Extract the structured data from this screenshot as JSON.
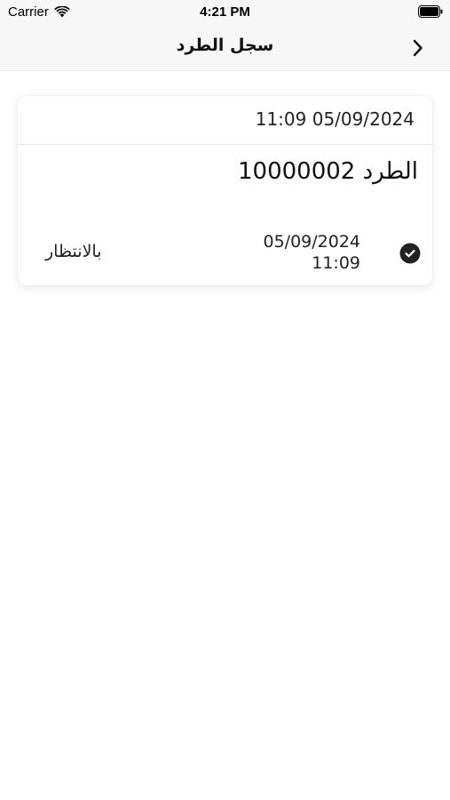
{
  "status_bar": {
    "carrier": "Carrier",
    "time": "4:21 PM"
  },
  "nav": {
    "title": "سجل الطرد",
    "back_icon": "chevron-right-icon"
  },
  "card": {
    "datetime": "11:09 05/09/2024",
    "parcel_title": "الطرد 10000002",
    "entry": {
      "date": "05/09/2024",
      "time": "11:09",
      "status": "بالانتظار",
      "icon": "check-circle-icon"
    }
  },
  "colors": {
    "bar_background": "#f7f7f7",
    "card_background": "#ffffff",
    "check_fill": "#222222"
  }
}
